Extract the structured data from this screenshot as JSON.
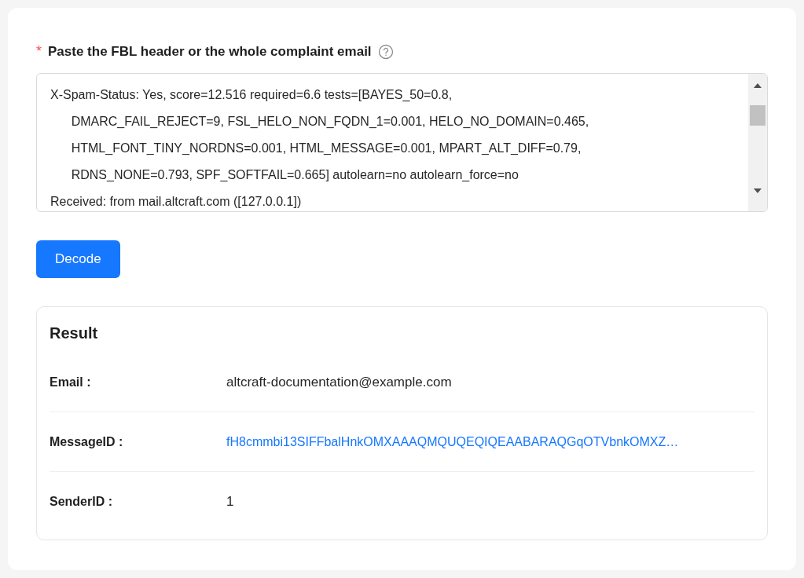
{
  "field": {
    "required_mark": "*",
    "label": "Paste the FBL header or the whole complaint email",
    "value": "X-Spam-Status: Yes, score=12.516 required=6.6 tests=[BAYES_50=0.8,\n      DMARC_FAIL_REJECT=9, FSL_HELO_NON_FQDN_1=0.001, HELO_NO_DOMAIN=0.465,\n      HTML_FONT_TINY_NORDNS=0.001, HTML_MESSAGE=0.001, MPART_ALT_DIFF=0.79,\n      RDNS_NONE=0.793, SPF_SOFTFAIL=0.665] autolearn=no autolearn_force=no\nReceived: from mail.altcraft.com ([127.0.0.1])"
  },
  "decode_button": "Decode",
  "result": {
    "title": "Result",
    "rows": [
      {
        "label": "Email :",
        "value": "altcraft-documentation@example.com",
        "kind": "text"
      },
      {
        "label": "MessageID :",
        "value": "fH8cmmbi13SIFFbalHnkOMXAAAQMQUQEQIQEAABARAQGqOTVbnkOMXZ…",
        "kind": "link"
      },
      {
        "label": "SenderID :",
        "value": "1",
        "kind": "text"
      }
    ]
  }
}
